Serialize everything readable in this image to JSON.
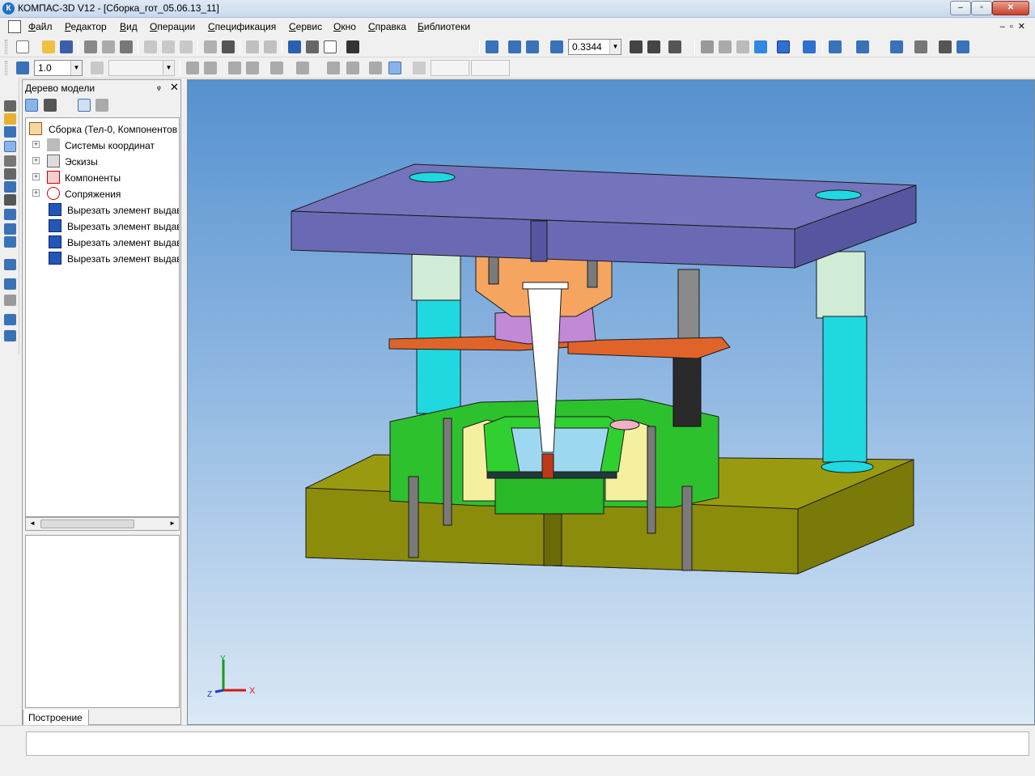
{
  "window": {
    "title": "КОМПАС-3D V12 - [Сборка_гот_05.06.13_11]",
    "app_icon": "К",
    "minimize": "–",
    "maximize": "▫",
    "close": "✕"
  },
  "menu": [
    "Файл",
    "Редактор",
    "Вид",
    "Операции",
    "Спецификация",
    "Сервис",
    "Окно",
    "Справка",
    "Библиотеки"
  ],
  "doc_controls": "–▫✕",
  "toolbar": {
    "zoom_value": "0.3344",
    "step_value": "1.0",
    "arrow": "▼"
  },
  "tree": {
    "title": "Дерево модели",
    "pin": "ᵩ",
    "close": "✕",
    "root": "Сборка (Тел-0, Компонентов",
    "items": [
      "Системы координат",
      "Эскизы",
      "Компоненты",
      "Сопряжения"
    ],
    "features": [
      "Вырезать элемент выдав",
      "Вырезать элемент выдав",
      "Вырезать элемент выдав",
      "Вырезать элемент выдав"
    ],
    "expand_sign": "+",
    "scroll_left": "◄",
    "scroll_right": "►",
    "tab": "Построение"
  },
  "axes": {
    "x": "X",
    "y": "Y",
    "z": "Z"
  },
  "colors": {
    "plate_top": "#7474bc",
    "plate_front": "#6a6ab4",
    "plate_right": "#5656a0",
    "pillar": "#1fd8e0",
    "pillar_top": "#d0ecd6",
    "base": "#9a9a10",
    "base_front": "#8c8c0c",
    "base_right": "#7a7a08",
    "die": "#2ec12e",
    "stripper": "#e0642a",
    "punch_holder": "#f5a560",
    "retainer": "#c28ad6",
    "cream": "#f4f0a0",
    "spring": "#2a2a2a",
    "screw": "#7a7a7a"
  }
}
